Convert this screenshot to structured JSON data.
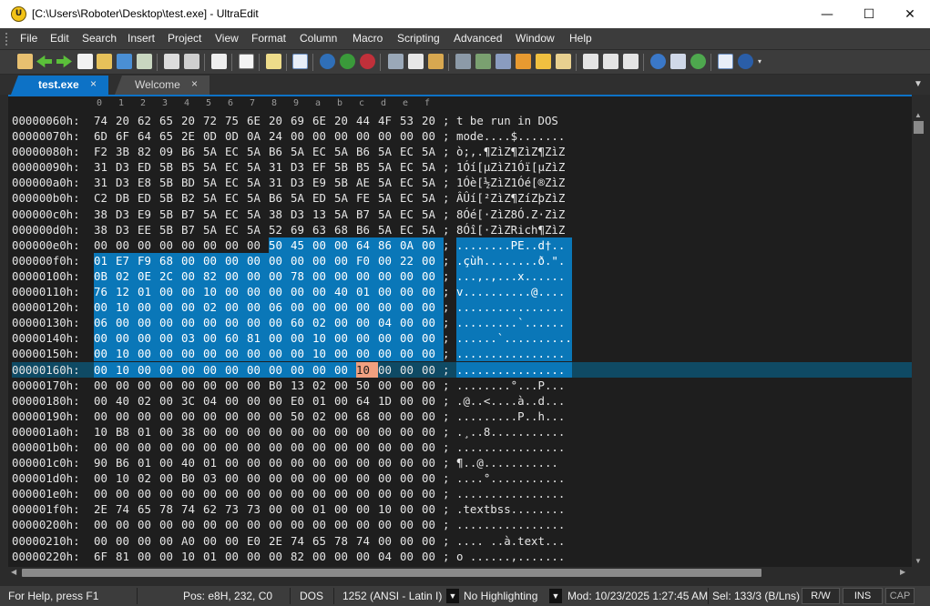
{
  "window": {
    "title": "[C:\\Users\\Roboter\\Desktop\\test.exe] - UltraEdit",
    "app_icon": "ultraedit-logo",
    "minimize": "—",
    "maximize": "☐",
    "close": "✕"
  },
  "menu": [
    "File",
    "Edit",
    "Search",
    "Insert",
    "Project",
    "View",
    "Format",
    "Column",
    "Macro",
    "Scripting",
    "Advanced",
    "Window",
    "Help"
  ],
  "tabs": [
    {
      "label": "test.exe",
      "active": true,
      "close": "×"
    },
    {
      "label": "Welcome",
      "active": false,
      "close": "×"
    }
  ],
  "ruler": [
    "0",
    "1",
    "2",
    "3",
    "4",
    "5",
    "6",
    "7",
    "8",
    "9",
    "a",
    "b",
    "c",
    "d",
    "e",
    "f"
  ],
  "hex_rows": [
    {
      "offset": "00000060h:",
      "bytes": [
        "74",
        "20",
        "62",
        "65",
        "20",
        "72",
        "75",
        "6E",
        "20",
        "69",
        "6E",
        "20",
        "44",
        "4F",
        "53",
        "20"
      ],
      "ascii": "t be run in DOS "
    },
    {
      "offset": "00000070h:",
      "bytes": [
        "6D",
        "6F",
        "64",
        "65",
        "2E",
        "0D",
        "0D",
        "0A",
        "24",
        "00",
        "00",
        "00",
        "00",
        "00",
        "00",
        "00"
      ],
      "ascii": "mode....$......."
    },
    {
      "offset": "00000080h:",
      "bytes": [
        "F2",
        "3B",
        "82",
        "09",
        "B6",
        "5A",
        "EC",
        "5A",
        "B6",
        "5A",
        "EC",
        "5A",
        "B6",
        "5A",
        "EC",
        "5A"
      ],
      "ascii": "ò;‚.¶ZìZ¶ZìZ¶ZìZ"
    },
    {
      "offset": "00000090h:",
      "bytes": [
        "31",
        "D3",
        "ED",
        "5B",
        "B5",
        "5A",
        "EC",
        "5A",
        "31",
        "D3",
        "EF",
        "5B",
        "B5",
        "5A",
        "EC",
        "5A"
      ],
      "ascii": "1Óí[µZìZ1Óï[µZìZ"
    },
    {
      "offset": "000000a0h:",
      "bytes": [
        "31",
        "D3",
        "E8",
        "5B",
        "BD",
        "5A",
        "EC",
        "5A",
        "31",
        "D3",
        "E9",
        "5B",
        "AE",
        "5A",
        "EC",
        "5A"
      ],
      "ascii": "1Óè[½ZìZ1Óé[®ZìZ"
    },
    {
      "offset": "000000b0h:",
      "bytes": [
        "C2",
        "DB",
        "ED",
        "5B",
        "B2",
        "5A",
        "EC",
        "5A",
        "B6",
        "5A",
        "ED",
        "5A",
        "FE",
        "5A",
        "EC",
        "5A"
      ],
      "ascii": "ÂÛí[²ZìZ¶ZíZþZìZ"
    },
    {
      "offset": "000000c0h:",
      "bytes": [
        "38",
        "D3",
        "E9",
        "5B",
        "B7",
        "5A",
        "EC",
        "5A",
        "38",
        "D3",
        "13",
        "5A",
        "B7",
        "5A",
        "EC",
        "5A"
      ],
      "ascii": "8Óé[·ZìZ8Ó.Z·ZìZ"
    },
    {
      "offset": "000000d0h:",
      "bytes": [
        "38",
        "D3",
        "EE",
        "5B",
        "B7",
        "5A",
        "EC",
        "5A",
        "52",
        "69",
        "63",
        "68",
        "B6",
        "5A",
        "EC",
        "5A"
      ],
      "ascii": "8Óî[·ZìZRich¶ZìZ"
    },
    {
      "offset": "000000e0h:",
      "bytes": [
        "00",
        "00",
        "00",
        "00",
        "00",
        "00",
        "00",
        "00",
        "50",
        "45",
        "00",
        "00",
        "64",
        "86",
        "0A",
        "00"
      ],
      "ascii": "........PE..d†.."
    },
    {
      "offset": "000000f0h:",
      "bytes": [
        "01",
        "E7",
        "F9",
        "68",
        "00",
        "00",
        "00",
        "00",
        "00",
        "00",
        "00",
        "00",
        "F0",
        "00",
        "22",
        "00"
      ],
      "ascii": ".çùh........ð.\"."
    },
    {
      "offset": "00000100h:",
      "bytes": [
        "0B",
        "02",
        "0E",
        "2C",
        "00",
        "82",
        "00",
        "00",
        "00",
        "78",
        "00",
        "00",
        "00",
        "00",
        "00",
        "00"
      ],
      "ascii": "...,.‚...x......"
    },
    {
      "offset": "00000110h:",
      "bytes": [
        "76",
        "12",
        "01",
        "00",
        "00",
        "10",
        "00",
        "00",
        "00",
        "00",
        "00",
        "40",
        "01",
        "00",
        "00",
        "00"
      ],
      "ascii": "v..........@...."
    },
    {
      "offset": "00000120h:",
      "bytes": [
        "00",
        "10",
        "00",
        "00",
        "00",
        "02",
        "00",
        "00",
        "06",
        "00",
        "00",
        "00",
        "00",
        "00",
        "00",
        "00"
      ],
      "ascii": "................"
    },
    {
      "offset": "00000130h:",
      "bytes": [
        "06",
        "00",
        "00",
        "00",
        "00",
        "00",
        "00",
        "00",
        "00",
        "60",
        "02",
        "00",
        "00",
        "04",
        "00",
        "00"
      ],
      "ascii": ".........`......"
    },
    {
      "offset": "00000140h:",
      "bytes": [
        "00",
        "00",
        "00",
        "00",
        "03",
        "00",
        "60",
        "81",
        "00",
        "00",
        "10",
        "00",
        "00",
        "00",
        "00",
        "00"
      ],
      "ascii": "......`.........."
    },
    {
      "offset": "00000150h:",
      "bytes": [
        "00",
        "10",
        "00",
        "00",
        "00",
        "00",
        "00",
        "00",
        "00",
        "00",
        "10",
        "00",
        "00",
        "00",
        "00",
        "00"
      ],
      "ascii": "................"
    },
    {
      "offset": "00000160h:",
      "bytes": [
        "00",
        "10",
        "00",
        "00",
        "00",
        "00",
        "00",
        "00",
        "00",
        "00",
        "00",
        "00",
        "10",
        "00",
        "00",
        "00"
      ],
      "ascii": "................"
    },
    {
      "offset": "00000170h:",
      "bytes": [
        "00",
        "00",
        "00",
        "00",
        "00",
        "00",
        "00",
        "00",
        "B0",
        "13",
        "02",
        "00",
        "50",
        "00",
        "00",
        "00"
      ],
      "ascii": "........°...P..."
    },
    {
      "offset": "00000180h:",
      "bytes": [
        "00",
        "40",
        "02",
        "00",
        "3C",
        "04",
        "00",
        "00",
        "00",
        "E0",
        "01",
        "00",
        "64",
        "1D",
        "00",
        "00"
      ],
      "ascii": ".@..<....à..d..."
    },
    {
      "offset": "00000190h:",
      "bytes": [
        "00",
        "00",
        "00",
        "00",
        "00",
        "00",
        "00",
        "00",
        "00",
        "50",
        "02",
        "00",
        "68",
        "00",
        "00",
        "00"
      ],
      "ascii": ".........P..h..."
    },
    {
      "offset": "000001a0h:",
      "bytes": [
        "10",
        "B8",
        "01",
        "00",
        "38",
        "00",
        "00",
        "00",
        "00",
        "00",
        "00",
        "00",
        "00",
        "00",
        "00",
        "00"
      ],
      "ascii": ".¸..8..........."
    },
    {
      "offset": "000001b0h:",
      "bytes": [
        "00",
        "00",
        "00",
        "00",
        "00",
        "00",
        "00",
        "00",
        "00",
        "00",
        "00",
        "00",
        "00",
        "00",
        "00",
        "00"
      ],
      "ascii": "................"
    },
    {
      "offset": "000001c0h:",
      "bytes": [
        "90",
        "B6",
        "01",
        "00",
        "40",
        "01",
        "00",
        "00",
        "00",
        "00",
        "00",
        "00",
        "00",
        "00",
        "00",
        "00"
      ],
      "ascii": "¶..@..........."
    },
    {
      "offset": "000001d0h:",
      "bytes": [
        "00",
        "10",
        "02",
        "00",
        "B0",
        "03",
        "00",
        "00",
        "00",
        "00",
        "00",
        "00",
        "00",
        "00",
        "00",
        "00"
      ],
      "ascii": "....°..........."
    },
    {
      "offset": "000001e0h:",
      "bytes": [
        "00",
        "00",
        "00",
        "00",
        "00",
        "00",
        "00",
        "00",
        "00",
        "00",
        "00",
        "00",
        "00",
        "00",
        "00",
        "00"
      ],
      "ascii": "................"
    },
    {
      "offset": "000001f0h:",
      "bytes": [
        "2E",
        "74",
        "65",
        "78",
        "74",
        "62",
        "73",
        "73",
        "00",
        "00",
        "01",
        "00",
        "00",
        "10",
        "00",
        "00"
      ],
      "ascii": ".textbss........"
    },
    {
      "offset": "00000200h:",
      "bytes": [
        "00",
        "00",
        "00",
        "00",
        "00",
        "00",
        "00",
        "00",
        "00",
        "00",
        "00",
        "00",
        "00",
        "00",
        "00",
        "00"
      ],
      "ascii": "................"
    },
    {
      "offset": "00000210h:",
      "bytes": [
        "00",
        "00",
        "00",
        "00",
        "A0",
        "00",
        "00",
        "E0",
        "2E",
        "74",
        "65",
        "78",
        "74",
        "00",
        "00",
        "00"
      ],
      "ascii": ".... ..à.text..."
    },
    {
      "offset": "00000220h:",
      "bytes": [
        "6F",
        "81",
        "00",
        "00",
        "10",
        "01",
        "00",
        "00",
        "00",
        "82",
        "00",
        "00",
        "00",
        "04",
        "00",
        "00"
      ],
      "ascii": "o ......‚......."
    }
  ],
  "separator": ";",
  "status": {
    "help": "For Help, press F1",
    "pos": "Pos: e8H, 232, C0",
    "line_ending": "DOS",
    "encoding": "1252  (ANSI - Latin I)",
    "highlighting": "No Highlighting",
    "modified": "Mod: 10/23/2025 1:27:45 AM",
    "selection": "Sel: 133/3 (B/Lns)",
    "rw": "R/W",
    "ins": "INS",
    "caps": "CAP"
  },
  "colors": {
    "selection": "#0a77b8",
    "caret": "#f0a080",
    "current_line": "#0f4a64",
    "tab_active": "#0d72c6"
  }
}
